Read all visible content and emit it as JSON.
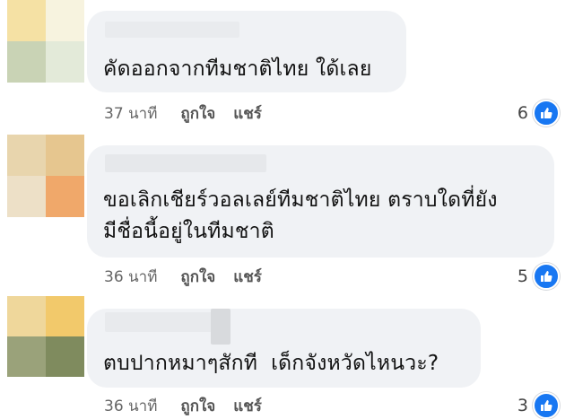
{
  "colors": {
    "bubble": "#f0f2f5",
    "like": "#1877f2",
    "meta_text": "#555555"
  },
  "comments": [
    {
      "text": "คัดออกจากทีมชาติไทย ใด้เลย",
      "time": "37 นาที",
      "like_label": "ถูกใจ",
      "share_label": "แชร์",
      "reaction_count": "6",
      "reaction_icon": "thumbs-up-icon",
      "avatar_colors": [
        "#f5e1a4",
        "#f7f3df",
        "#c9d3b5",
        "#e3ead9"
      ]
    },
    {
      "text": "ขอเลิกเชียร์วอลเลย์ทีมชาติไทย ตราบใดที่ยัง\nมีชื่อนี้อยู่ในทีมชาติ",
      "time": "36 นาที",
      "like_label": "ถูกใจ",
      "share_label": "แชร์",
      "reaction_count": "5",
      "reaction_icon": "thumbs-up-icon",
      "avatar_colors": [
        "#e8d5ad",
        "#e6c68f",
        "#ede0c7",
        "#f0a86a"
      ]
    },
    {
      "text": "ตบปากหมาๆสักที  เด็กจังหวัดไหนวะ?",
      "time": "36 นาที",
      "like_label": "ถูกใจ",
      "share_label": "แชร์",
      "reaction_count": "3",
      "reaction_icon": "thumbs-up-icon",
      "avatar_colors": [
        "#efd79b",
        "#f2c96b",
        "#9aa27a",
        "#7f8b5e"
      ]
    }
  ]
}
